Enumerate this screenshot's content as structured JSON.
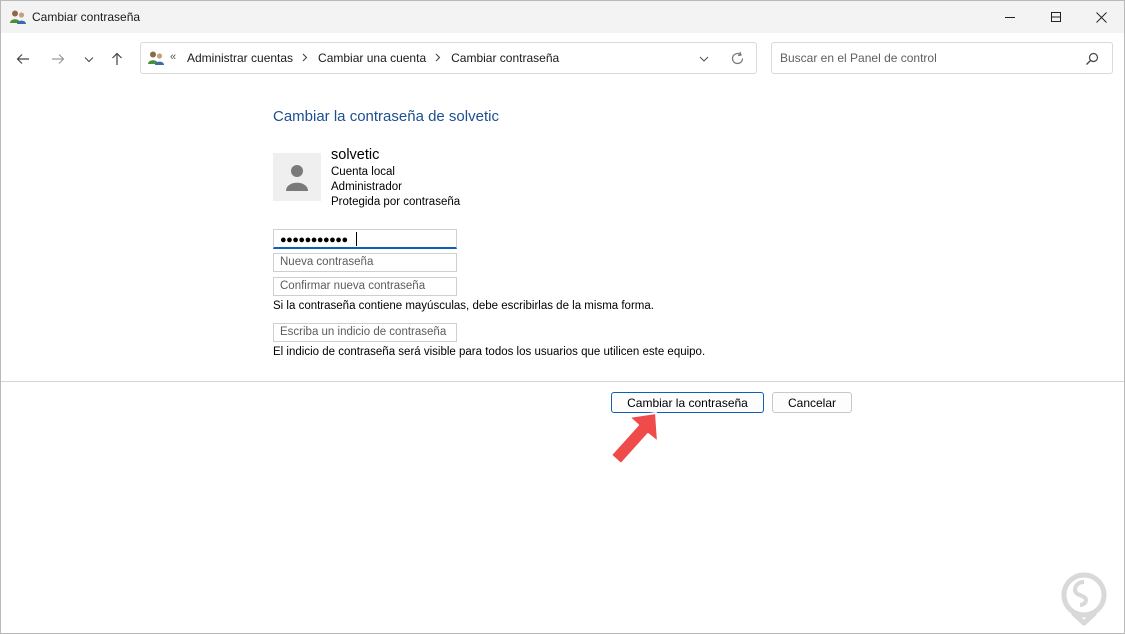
{
  "window": {
    "title": "Cambiar contraseña",
    "controls": [
      "minimize",
      "maximize",
      "close"
    ]
  },
  "navigation": {
    "back": "back-arrow",
    "forward": "forward-arrow",
    "recent": "chevron-down",
    "up": "up-arrow"
  },
  "address": {
    "overflow": "«",
    "crumbs": [
      "Administrar cuentas",
      "Cambiar una cuenta",
      "Cambiar contraseña"
    ]
  },
  "search": {
    "placeholder": "Buscar en el Panel de control"
  },
  "main": {
    "heading": "Cambiar la contraseña de solvetic",
    "user": {
      "name": "solvetic",
      "lines": [
        "Cuenta local",
        "Administrador",
        "Protegida por contraseña"
      ]
    },
    "current_password_value": "●●●●●●●●●●●",
    "new_password_placeholder": "Nueva contraseña",
    "confirm_password_placeholder": "Confirmar nueva contraseña",
    "case_note": "Si la contraseña contiene mayúsculas, debe escribirlas de la misma forma.",
    "hint_placeholder": "Escriba un indicio de contraseña",
    "hint_note": "El indicio de contraseña será visible para todos los usuarios que utilicen este equipo."
  },
  "buttons": {
    "change": "Cambiar la contraseña",
    "cancel": "Cancelar"
  },
  "colors": {
    "heading": "#1d4f91",
    "focus_border": "#0f5fb8",
    "arrow": "#ef4b4b",
    "titlebar": "#f3f3f3"
  }
}
